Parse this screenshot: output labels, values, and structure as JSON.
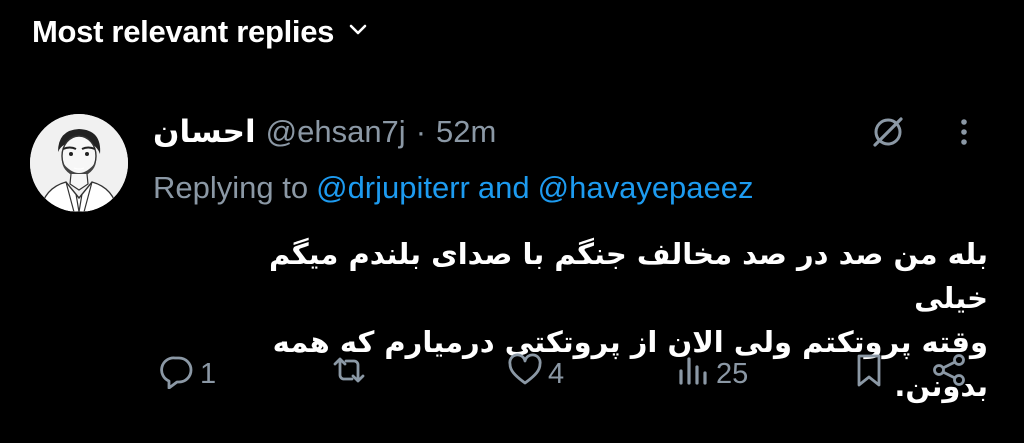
{
  "header": {
    "title": "Most relevant replies",
    "chevron_icon": "chevron-down-icon"
  },
  "tweet": {
    "display_name": "احسان",
    "handle": "@ehsan7j",
    "separator": "·",
    "time": "52m",
    "replying_prefix": "Replying to",
    "mention_1": "@drjupiterr",
    "conjunction": "and",
    "mention_2": "@havayepaeez",
    "text_line_1": "بله من صد در صد مخالف جنگم با صدای بلندم میگم خیلی",
    "text_line_2": "وقته پروتکتم ولی الان از پروتکتی درمیارم که همه بدونن."
  },
  "actions": {
    "reply_count": "1",
    "repost_count": "",
    "like_count": "4",
    "views_count": "25"
  },
  "icons": [
    "grok-icon",
    "more-icon",
    "reply-icon",
    "repost-icon",
    "like-icon",
    "views-icon",
    "bookmark-icon",
    "share-icon"
  ],
  "colors": {
    "background": "#000000",
    "text": "#e7e9ea",
    "muted": "#8b98a5",
    "link": "#1d9bf0"
  }
}
